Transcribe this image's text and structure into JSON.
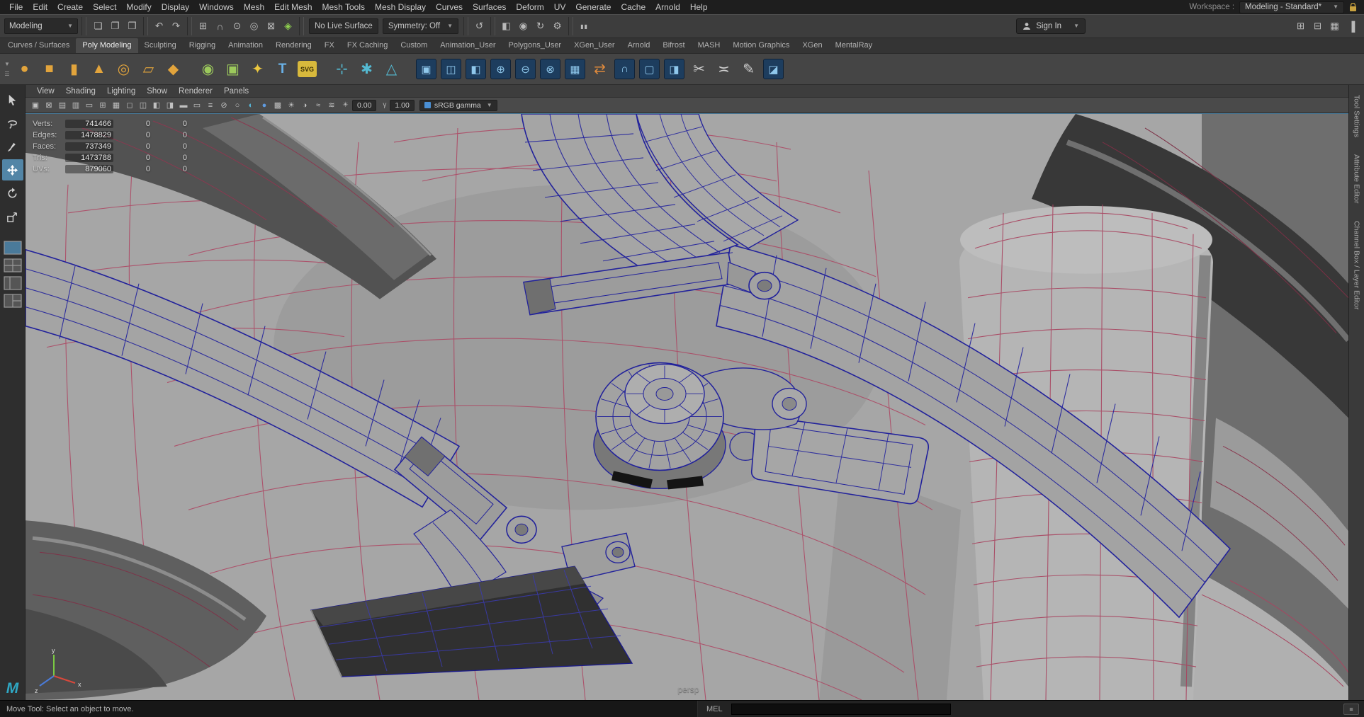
{
  "colors": {
    "accent_blue": "#5285a6",
    "selected_wireframe": "#22229b",
    "unselected_wireframe": "#ad4763",
    "viewport_surface": "#a6a6a6"
  },
  "menubar": {
    "items": [
      {
        "label": "File"
      },
      {
        "label": "Edit"
      },
      {
        "label": "Create"
      },
      {
        "label": "Select"
      },
      {
        "label": "Modify"
      },
      {
        "label": "Display"
      },
      {
        "label": "Windows"
      },
      {
        "label": "Mesh"
      },
      {
        "label": "Edit Mesh"
      },
      {
        "label": "Mesh Tools"
      },
      {
        "label": "Mesh Display"
      },
      {
        "label": "Curves"
      },
      {
        "label": "Surfaces"
      },
      {
        "label": "Deform"
      },
      {
        "label": "UV"
      },
      {
        "label": "Generate"
      },
      {
        "label": "Cache"
      },
      {
        "label": "Arnold"
      },
      {
        "label": "Help"
      }
    ],
    "workspace_label": "Workspace :",
    "workspace_value": "Modeling - Standard*"
  },
  "statusline": {
    "menuset": "Modeling",
    "icons_a": [
      {
        "name": "new-scene-icon",
        "glyph": "❏",
        "kind": "g"
      },
      {
        "name": "open-scene-icon",
        "glyph": "❐",
        "kind": "g"
      },
      {
        "name": "save-scene-icon",
        "glyph": "❒",
        "kind": "g"
      },
      {
        "name": "separator",
        "glyph": "",
        "kind": "sep"
      },
      {
        "name": "undo-icon",
        "glyph": "↶",
        "kind": "g"
      },
      {
        "name": "redo-icon",
        "glyph": "↷",
        "kind": "g"
      },
      {
        "name": "separator",
        "glyph": "",
        "kind": "sep"
      },
      {
        "name": "snap-to-grid-icon",
        "glyph": "⊞",
        "kind": "g"
      },
      {
        "name": "snap-to-curve-icon",
        "glyph": "∩",
        "kind": "g"
      },
      {
        "name": "snap-to-point-icon",
        "glyph": "⊙",
        "kind": "g"
      },
      {
        "name": "snap-to-projected-center-icon",
        "glyph": "◎",
        "kind": "g"
      },
      {
        "name": "snap-to-view-plane-icon",
        "glyph": "⊠",
        "kind": "g"
      },
      {
        "name": "make-live-icon",
        "glyph": "◈",
        "kind": "green"
      },
      {
        "name": "separator",
        "glyph": "",
        "kind": "sep"
      }
    ],
    "live_surface": "No Live Surface",
    "symmetry": "Symmetry: Off",
    "icons_b": [
      {
        "name": "separator",
        "glyph": "",
        "kind": "sep"
      },
      {
        "name": "construction-history-icon",
        "glyph": "↺",
        "kind": "g"
      },
      {
        "name": "separator",
        "glyph": "",
        "kind": "sep"
      },
      {
        "name": "open-render-view-icon",
        "glyph": "◧",
        "kind": "g"
      },
      {
        "name": "render-current-frame-icon",
        "glyph": "◉",
        "kind": "g"
      },
      {
        "name": "ipr-render-icon",
        "glyph": "↻",
        "kind": "g"
      },
      {
        "name": "render-settings-icon",
        "glyph": "⚙",
        "kind": "g"
      },
      {
        "name": "separator",
        "glyph": "",
        "kind": "sep"
      },
      {
        "name": "pause-viewport-icon",
        "glyph": "▮▮",
        "kind": "pause"
      }
    ],
    "sign_in": "Sign In",
    "end_icons": [
      {
        "name": "toggle-panel-grid-icon",
        "glyph": "⊞",
        "kind": "g"
      },
      {
        "name": "toggle-panel-rows-icon",
        "glyph": "⊟",
        "kind": "g"
      },
      {
        "name": "toggle-panel-full-icon",
        "glyph": "▦",
        "kind": "g"
      },
      {
        "name": "toggle-sidebar-icon",
        "glyph": "▐",
        "kind": "g"
      }
    ]
  },
  "shelf": {
    "tabs": [
      {
        "label": "Curves / Surfaces"
      },
      {
        "label": "Poly Modeling",
        "active": true
      },
      {
        "label": "Sculpting"
      },
      {
        "label": "Rigging"
      },
      {
        "label": "Animation"
      },
      {
        "label": "Rendering"
      },
      {
        "label": "FX"
      },
      {
        "label": "FX Caching"
      },
      {
        "label": "Custom"
      },
      {
        "label": "Animation_User"
      },
      {
        "label": "Polygons_User"
      },
      {
        "label": "XGen_User"
      },
      {
        "label": "Arnold"
      },
      {
        "label": "Bifrost"
      },
      {
        "label": "MASH"
      },
      {
        "label": "Motion Graphics"
      },
      {
        "label": "XGen"
      },
      {
        "label": "MentalRay"
      }
    ],
    "icons": [
      {
        "name": "poly-sphere-icon",
        "glyph": "●",
        "kind": "prim"
      },
      {
        "name": "poly-cube-icon",
        "glyph": "■",
        "kind": "prim"
      },
      {
        "name": "poly-cylinder-icon",
        "glyph": "▮",
        "kind": "prim"
      },
      {
        "name": "poly-cone-icon",
        "glyph": "▲",
        "kind": "prim"
      },
      {
        "name": "poly-torus-icon",
        "glyph": "◎",
        "kind": "prim"
      },
      {
        "name": "poly-plane-icon",
        "glyph": "▱",
        "kind": "prim"
      },
      {
        "name": "poly-platonic-icon",
        "glyph": "◆",
        "kind": "prim"
      },
      {
        "name": "gap",
        "glyph": "",
        "kind": "gap"
      },
      {
        "name": "sculpt-tool-icon",
        "glyph": "◉",
        "kind": "green"
      },
      {
        "name": "sculpt-smooth-tool-icon",
        "glyph": "▣",
        "kind": "green"
      },
      {
        "name": "sculpt-sparkle-icon",
        "glyph": "✦",
        "kind": "yellow"
      },
      {
        "name": "type-tool-icon",
        "glyph": "T",
        "kind": "blueletter"
      },
      {
        "name": "svg-tool-icon",
        "glyph": "SVG",
        "kind": "yellowtext"
      },
      {
        "name": "gap",
        "glyph": "",
        "kind": "gap"
      },
      {
        "name": "align-tool-icon",
        "glyph": "⊹",
        "kind": "teal"
      },
      {
        "name": "snap-together-icon",
        "glyph": "✱",
        "kind": "teal"
      },
      {
        "name": "symmetry-tool-icon",
        "glyph": "△",
        "kind": "teal"
      },
      {
        "name": "gap",
        "glyph": "",
        "kind": "gap"
      },
      {
        "name": "combine-icon",
        "glyph": "▣",
        "kind": "navy"
      },
      {
        "name": "separate-icon",
        "glyph": "◫",
        "kind": "navy"
      },
      {
        "name": "extract-icon",
        "glyph": "◧",
        "kind": "navy"
      },
      {
        "name": "boolean-union-icon",
        "glyph": "⊕",
        "kind": "navy"
      },
      {
        "name": "boolean-difference-icon",
        "glyph": "⊖",
        "kind": "navy"
      },
      {
        "name": "boolean-intersection-icon",
        "glyph": "⊗",
        "kind": "navy"
      },
      {
        "name": "smooth-icon",
        "glyph": "▦",
        "kind": "navy"
      },
      {
        "name": "mirror-icon",
        "glyph": "⇄",
        "kind": "orange"
      },
      {
        "name": "bridge-icon",
        "glyph": "∩",
        "kind": "navy"
      },
      {
        "name": "fill-hole-icon",
        "glyph": "▢",
        "kind": "navy"
      },
      {
        "name": "append-polygon-icon",
        "glyph": "◨",
        "kind": "navy"
      },
      {
        "name": "multi-cut-icon",
        "glyph": "✂",
        "kind": "gray"
      },
      {
        "name": "connect-icon",
        "glyph": "≍",
        "kind": "gray"
      },
      {
        "name": "quad-draw-icon",
        "glyph": "✎",
        "kind": "gray"
      },
      {
        "name": "bevel-icon",
        "glyph": "◪",
        "kind": "navy"
      }
    ]
  },
  "toolbox": {
    "tools": [
      "select-tool",
      "lasso-tool",
      "paint-select-tool",
      "move-tool",
      "rotate-tool",
      "scale-tool"
    ],
    "active_tool": "move-tool",
    "layouts": [
      "single-pane-layout",
      "four-pane-layout",
      "persp-outliner-layout",
      "split-pane-layout"
    ]
  },
  "panel": {
    "menus": [
      {
        "label": "View"
      },
      {
        "label": "Shading"
      },
      {
        "label": "Lighting"
      },
      {
        "label": "Show"
      },
      {
        "label": "Renderer"
      },
      {
        "label": "Panels"
      }
    ],
    "toolbar_icons": [
      {
        "name": "select-camera-icon",
        "glyph": "▣",
        "kind": "g"
      },
      {
        "name": "lock-camera-icon",
        "glyph": "⊠",
        "kind": "g"
      },
      {
        "name": "camera-attributes-icon",
        "glyph": "▤",
        "kind": "g"
      },
      {
        "name": "bookmarks-icon",
        "glyph": "▥",
        "kind": "g"
      },
      {
        "name": "image-plane-icon",
        "glyph": "▭",
        "kind": "g"
      },
      {
        "name": "pan-zoom-icon",
        "glyph": "⊞",
        "kind": "g"
      },
      {
        "name": "grid-icon",
        "glyph": "▦",
        "kind": "g"
      },
      {
        "name": "film-gate-icon",
        "glyph": "◻",
        "kind": "g"
      },
      {
        "name": "resolution-gate-icon",
        "glyph": "◫",
        "kind": "g"
      },
      {
        "name": "gate-mask-icon",
        "glyph": "◧",
        "kind": "g"
      },
      {
        "name": "field-chart-icon",
        "glyph": "◨",
        "kind": "g"
      },
      {
        "name": "safe-action-icon",
        "glyph": "▬",
        "kind": "g"
      },
      {
        "name": "safe-title-icon",
        "glyph": "▭",
        "kind": "g"
      },
      {
        "name": "hud-toggle-icon",
        "glyph": "≡",
        "kind": "g"
      },
      {
        "name": "xray-icon",
        "glyph": "⊘",
        "kind": "g"
      },
      {
        "name": "wireframe-on-shaded-icon",
        "glyph": "○",
        "kind": "g"
      },
      {
        "name": "default-material-icon",
        "glyph": "◐",
        "kind": "teal"
      },
      {
        "name": "shaded-display-icon",
        "glyph": "●",
        "kind": "blue"
      },
      {
        "name": "textured-display-icon",
        "glyph": "▩",
        "kind": "g"
      },
      {
        "name": "lights-icon",
        "glyph": "☀",
        "kind": "g"
      },
      {
        "name": "shadows-icon",
        "glyph": "◑",
        "kind": "g"
      },
      {
        "name": "ambient-occlusion-icon",
        "glyph": "≈",
        "kind": "g"
      },
      {
        "name": "motion-blur-icon",
        "glyph": "≋",
        "kind": "g"
      }
    ],
    "exposure": "0.00",
    "gamma": "1.00",
    "exposure_icon": "☀",
    "gamma_icon": "γ",
    "view_transform": "sRGB gamma"
  },
  "hud": {
    "rows": [
      {
        "label": "Verts:",
        "value": "741466",
        "c2": "0",
        "c3": "0"
      },
      {
        "label": "Edges:",
        "value": "1478829",
        "c2": "0",
        "c3": "0"
      },
      {
        "label": "Faces:",
        "value": "737349",
        "c2": "0",
        "c3": "0"
      },
      {
        "label": "Tris:",
        "value": "1473788",
        "c2": "0",
        "c3": "0"
      },
      {
        "label": "UVs:",
        "value": "879060",
        "c2": "0",
        "c3": "0"
      }
    ]
  },
  "viewport": {
    "camera_label": "persp"
  },
  "right_tabs": {
    "tool_settings": "Tool Settings",
    "attribute_editor": "Attribute Editor",
    "channel_box": "Channel Box / Layer Editor"
  },
  "bottombar": {
    "help_text": "Move Tool: Select an object to move.",
    "command_label": "MEL"
  }
}
